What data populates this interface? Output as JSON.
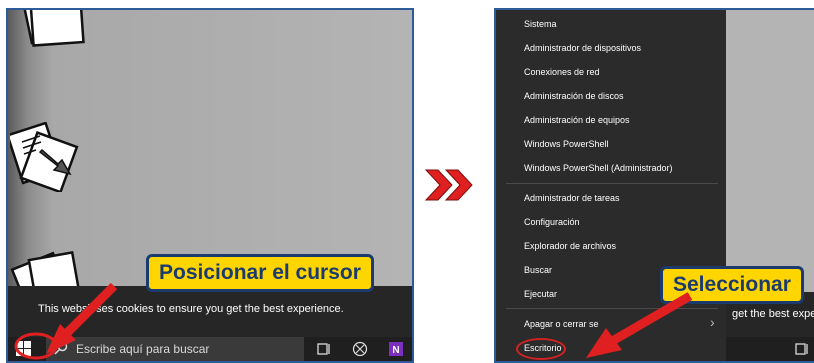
{
  "left_screen": {
    "callout": "Posicionar el cursor",
    "cookie_text": "This websit    ses cookies to ensure you get the best experience.",
    "search_placeholder": "Escribe aquí para buscar",
    "icons": [
      "windows-start-icon",
      "search-icon",
      "task-view-icon",
      "xbox-icon",
      "onenote-icon"
    ]
  },
  "right_screen": {
    "callout": "Seleccionar",
    "cookie_fragment": "get the best experie",
    "menu_items": [
      "Sistema",
      "Administrador de dispositivos",
      "Conexiones de red",
      "Administración de discos",
      "Administración de equipos",
      "Windows PowerShell",
      "Windows PowerShell (Administrador)",
      "Administrador de tareas",
      "Configuración",
      "Explorador de archivos",
      "Buscar",
      "Ejecutar",
      "Apagar o cerrar se",
      "Escritorio"
    ],
    "submenu_arrow": "›"
  },
  "colors": {
    "callout_fill": "#ffd500",
    "callout_text": "#1b3b6f",
    "arrow": "#e02020",
    "chevron": "#e02020",
    "frame": "#2f5b9a"
  }
}
